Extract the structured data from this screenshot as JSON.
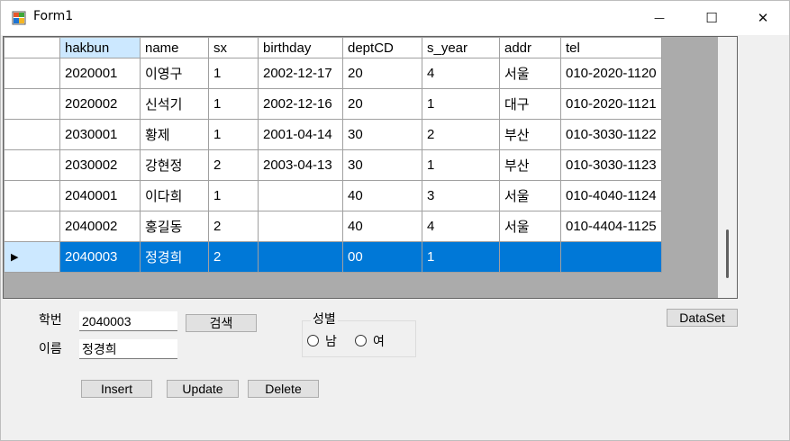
{
  "window": {
    "title": "Form1"
  },
  "titlebar": {
    "min_glyph": "—",
    "max_glyph": "☐",
    "close_glyph": "✕"
  },
  "grid": {
    "columns": [
      "hakbun",
      "name",
      "sx",
      "birthday",
      "deptCD",
      "s_year",
      "addr",
      "tel"
    ],
    "rows": [
      [
        "2020001",
        "이영구",
        "1",
        "2002-12-17",
        "20",
        "4",
        "서울",
        "010-2020-1120"
      ],
      [
        "2020002",
        "신석기",
        "1",
        "2002-12-16",
        "20",
        "1",
        "대구",
        "010-2020-1121"
      ],
      [
        "2030001",
        "황제",
        "1",
        "2001-04-14",
        "30",
        "2",
        "부산",
        "010-3030-1122"
      ],
      [
        "2030002",
        "강현정",
        "2",
        "2003-04-13",
        "30",
        "1",
        "부산",
        "010-3030-1123"
      ],
      [
        "2040001",
        "이다희",
        "1",
        "",
        "40",
        "3",
        "서울",
        "010-4040-1124"
      ],
      [
        "2040002",
        "홍길동",
        "2",
        "",
        "40",
        "4",
        "서울",
        "010-4404-1125"
      ],
      [
        "2040003",
        "정경희",
        "2",
        "",
        "00",
        "1",
        "",
        ""
      ]
    ],
    "selected_row_marker": "▶"
  },
  "form": {
    "hakbun_label": "학번",
    "hakbun_value": "2040003",
    "search_button": "검색",
    "name_label": "이름",
    "name_value": "정경희",
    "gender_group": "성별",
    "male_label": "남",
    "female_label": "여",
    "dataset_button": "DataSet",
    "insert_button": "Insert",
    "update_button": "Update",
    "delete_button": "Delete"
  },
  "colors": {
    "selection": "#0078d7",
    "header_selection": "#cce8ff"
  }
}
